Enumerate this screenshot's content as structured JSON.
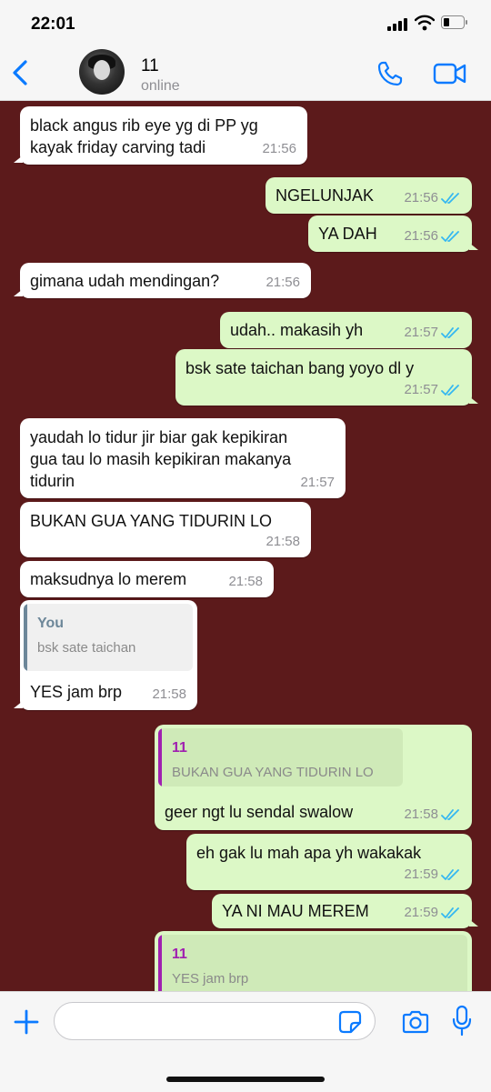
{
  "status_bar": {
    "time": "22:01"
  },
  "header": {
    "contact_name": "11",
    "contact_status": "online"
  },
  "colors": {
    "chat_background": "#5c1a1b",
    "incoming_bubble": "#ffffff",
    "outgoing_bubble": "#dcf8c6",
    "accent": "#0a7aff",
    "read_ticks": "#34b7f1"
  },
  "icons": {
    "back": "chevron-left-icon",
    "call": "phone-icon",
    "video": "video-camera-icon",
    "plus": "plus-icon",
    "sticker": "sticker-icon",
    "camera": "camera-icon",
    "mic": "microphone-icon"
  },
  "messages": [
    {
      "from": "contact",
      "text": "black angus rib eye yg di PP yg\nkayak friday carving tadi",
      "time": "21:56"
    },
    {
      "from": "me",
      "text": "NGELUNJAK",
      "time": "21:56",
      "status": "read"
    },
    {
      "from": "me",
      "text": "YA DAH",
      "time": "21:56",
      "status": "read"
    },
    {
      "from": "contact",
      "text": "gimana udah mendingan?",
      "time": "21:56"
    },
    {
      "from": "me",
      "text": "udah.. makasih yh",
      "time": "21:57",
      "status": "read"
    },
    {
      "from": "me",
      "text": "bsk sate taichan bang yoyo dl y",
      "time": "21:57",
      "status": "read"
    },
    {
      "from": "contact",
      "text": "yaudah lo tidur jir biar gak kepikiran\ngua tau lo masih kepikiran makanya\ntidurin",
      "time": "21:57"
    },
    {
      "from": "contact",
      "text": "BUKAN GUA YANG TIDURIN LO",
      "time": "21:58"
    },
    {
      "from": "contact",
      "text": "maksudnya lo merem",
      "time": "21:58"
    },
    {
      "from": "contact",
      "text": "YES jam brp",
      "time": "21:58",
      "quote": {
        "author": "You",
        "text": "bsk sate taichan"
      }
    },
    {
      "from": "me",
      "text": "geer ngt lu sendal swalow",
      "time": "21:58",
      "status": "read",
      "quote": {
        "author": "11",
        "text": "BUKAN GUA YANG TIDURIN LO"
      }
    },
    {
      "from": "me",
      "text": "eh gak lu mah apa yh wakakak",
      "time": "21:59",
      "status": "read"
    },
    {
      "from": "me",
      "text": "YA NI MAU MEREM",
      "time": "21:59",
      "status": "read"
    },
    {
      "from": "me",
      "text": "",
      "time": "",
      "quote": {
        "author": "11",
        "text": "YES jam brp"
      }
    }
  ],
  "input": {
    "placeholder": "",
    "value": ""
  }
}
